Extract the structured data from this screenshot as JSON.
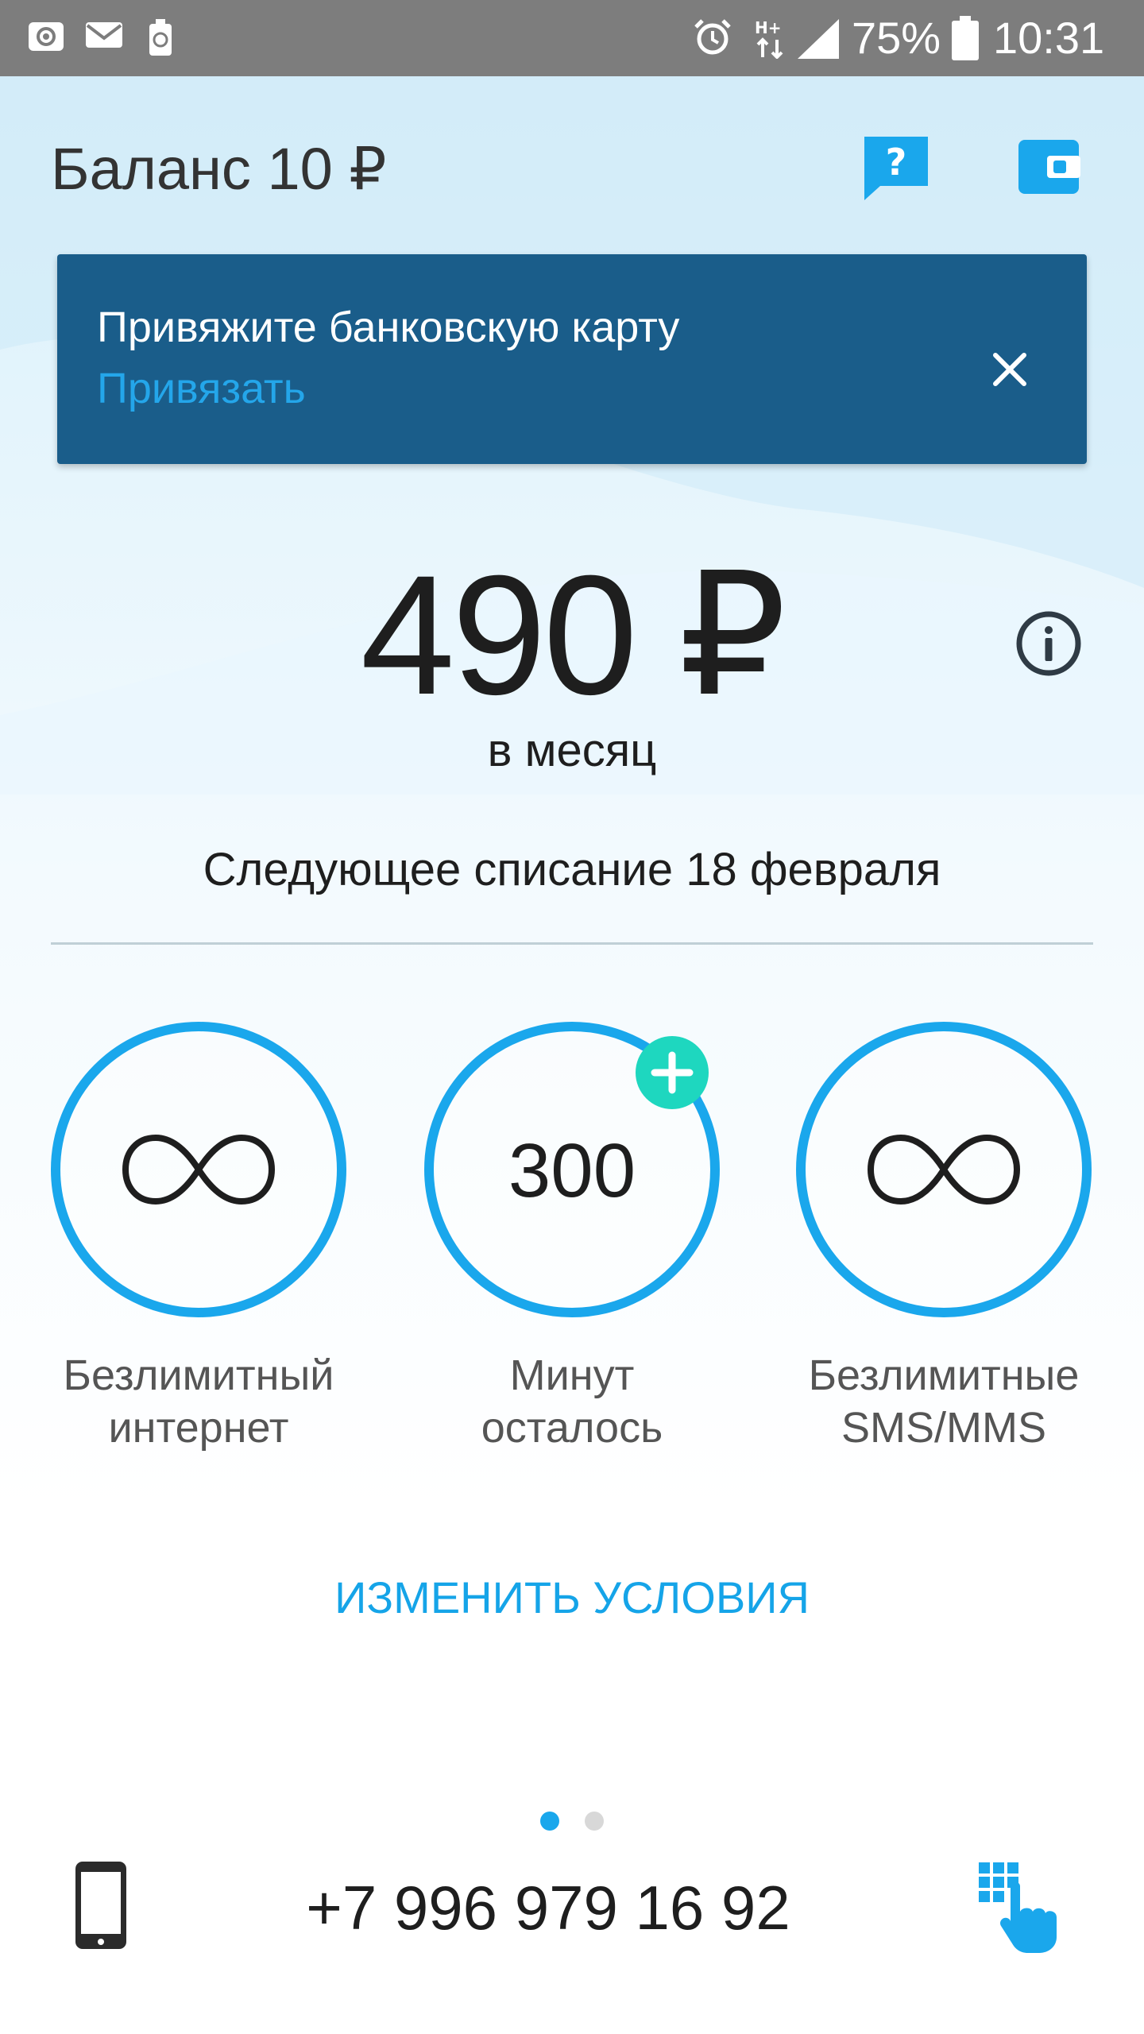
{
  "status_bar": {
    "notification_icons": [
      "at-sign-icon",
      "mail-icon",
      "recycle-battery-icon"
    ],
    "right_icons": [
      "alarm-icon",
      "hplus-data-icon",
      "signal-icon",
      "battery-icon"
    ],
    "battery_percent": "75%",
    "time": "10:31"
  },
  "header": {
    "balance_label": "Баланс 10 ₽",
    "help_icon": "question-chat-icon",
    "wallet_icon": "wallet-icon"
  },
  "banner": {
    "text": "Привяжите банковскую карту",
    "link_label": "Привязать",
    "close_icon": "close-icon"
  },
  "tariff": {
    "price": "490 ₽",
    "period": "в месяц",
    "info_icon": "info-icon",
    "next_charge": "Следующее списание 18 февраля"
  },
  "packages": [
    {
      "icon": "infinity-icon",
      "label_line1": "Безлимитный",
      "label_line2": "интернет"
    },
    {
      "value": "300",
      "label_line1": "Минут",
      "label_line2": "осталось",
      "add_icon": "plus-icon"
    },
    {
      "icon": "infinity-icon",
      "label_line1": "Безлимитные",
      "label_line2": "SMS/MMS"
    }
  ],
  "change_terms_label": "ИЗМЕНИТЬ УСЛОВИЯ",
  "pager": {
    "current": 1,
    "total": 2
  },
  "bottom": {
    "phone_icon": "smartphone-icon",
    "phone_number": "+7 996 979 16 92",
    "dialpad_icon": "dialpad-hand-icon"
  },
  "colors": {
    "accent": "#1aa7ec",
    "banner_bg": "#1a5d8a",
    "add_button": "#1ed7bf",
    "status_bar": "#7d7d7d",
    "text_primary": "#1e1e1e"
  }
}
